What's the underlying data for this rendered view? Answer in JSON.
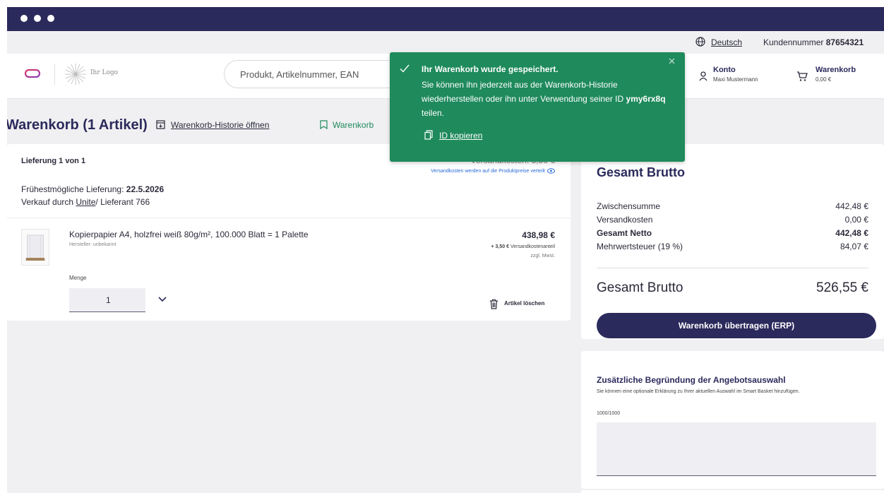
{
  "utility": {
    "language": "Deutsch",
    "customer_label": "Kundennummer",
    "customer_number": "87654321"
  },
  "header": {
    "your_logo": "Ihr Logo",
    "search_placeholder": "Produkt, Artikelnummer, EAN",
    "account_title": "Konto",
    "account_user": "Maxi Mustermann",
    "cart_title": "Warenkorb",
    "cart_total": "0,00 €"
  },
  "page": {
    "title": "Warenkorb (1 Artikel)",
    "history_link": "Warenkorb-Historie öffnen",
    "save_link": "Warenkorb"
  },
  "delivery": {
    "heading": "Lieferung 1 von 1",
    "shipping_cost": "Versandkosten: 3,50 €",
    "shipping_note": "Versandkosten werden auf die Produktpreise verteilt",
    "earliest_label": "Frühestmögliche Lieferung:",
    "earliest_date": "22.5.2026",
    "seller_prefix": "Verkauf durch",
    "seller_name": "Unite",
    "seller_suffix": "/ Lieferant 766"
  },
  "item": {
    "name": "Kopierpapier A4, holzfrei weiß 80g/m², 100.000 Blatt = 1 Palette",
    "manufacturer": "Hersteller: unbekannt",
    "price": "438,98 €",
    "shipping_share_amount": "+ 3,50 €",
    "shipping_share_label": "Versandkostenanteil",
    "vat_note": "zzgl. Mwst.",
    "quantity_label": "Menge",
    "quantity": "1",
    "delete_label": "Artikel löschen"
  },
  "summary": {
    "title": "Gesamt Brutto",
    "rows": [
      {
        "label": "Zwischensumme",
        "value": "442,48 €"
      },
      {
        "label": "Versandkosten",
        "value": "0,00 €"
      },
      {
        "label": "Gesamt Netto",
        "value": "442,48 €"
      },
      {
        "label": "Mehrwertsteuer (19 %)",
        "value": "84,07 €"
      }
    ],
    "total_label": "Gesamt Brutto",
    "total_value": "526,55 €",
    "button": "Warenkorb übertragen (ERP)"
  },
  "justification": {
    "title": "Zusätzliche Begründung der Angebotsauswahl",
    "description": "Sie können eine optionale Erklärung zu Ihrer aktuellen Auswahl im Smart Basket hinzufügen.",
    "counter": "1000/1000"
  },
  "toast": {
    "title": "Ihr Warenkorb wurde gespeichert.",
    "body_prefix": "Sie können ihn jederzeit aus der Warenkorb-Historie wiederherstellen oder ihn unter Verwendung seiner ID",
    "id": "ymy6rx8q",
    "body_suffix": "teilen.",
    "copy_label": "ID kopieren"
  },
  "colors": {
    "brand": "#2b2a5c",
    "success": "#1f8a5c",
    "link": "#2b6bd8"
  },
  "icons": [
    "globe-icon",
    "brand-logo-icon",
    "your-logo-icon",
    "account-icon",
    "cart-icon",
    "history-icon",
    "bookmark-icon",
    "eye-icon",
    "chevron-down-icon",
    "trash-icon",
    "check-icon",
    "close-icon",
    "copy-icon"
  ]
}
